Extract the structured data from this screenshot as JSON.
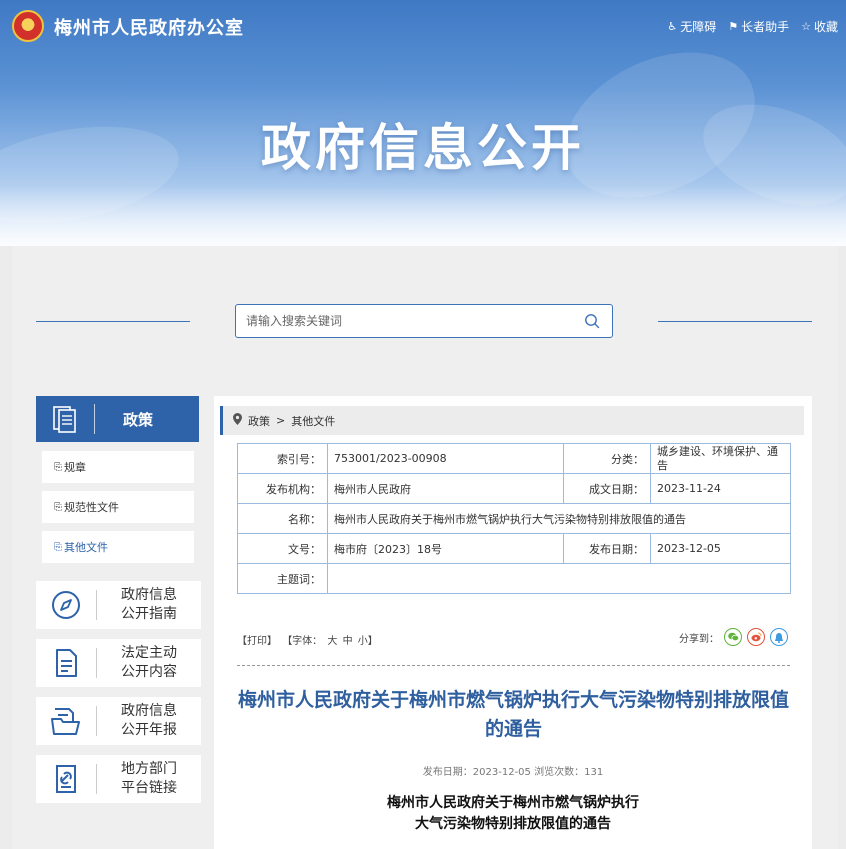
{
  "header": {
    "site_title": "梅州市人民政府办公室",
    "links": [
      {
        "icon": "wheelchair-icon",
        "label": "无障碍"
      },
      {
        "icon": "elder-helper-icon",
        "label": "长者助手"
      },
      {
        "icon": "star-icon",
        "label": "收藏"
      }
    ],
    "banner_title": "政府信息公开"
  },
  "search": {
    "placeholder": "请输入搜索关键词"
  },
  "sidebar": {
    "header_label": "政策",
    "sub_items": [
      {
        "label": "规章"
      },
      {
        "label": "规范性文件"
      },
      {
        "label": "其他文件"
      }
    ],
    "cards": [
      {
        "line1": "政府信息",
        "line2": "公开指南",
        "icon": "compass-icon"
      },
      {
        "line1": "法定主动",
        "line2": "公开内容",
        "icon": "document-list-icon"
      },
      {
        "line1": "政府信息",
        "line2": "公开年报",
        "icon": "folder-report-icon"
      },
      {
        "line1": "地方部门",
        "line2": "平台链接",
        "icon": "link-document-icon"
      }
    ]
  },
  "breadcrumb": {
    "items": [
      "政策",
      "其他文件"
    ],
    "separator": ">"
  },
  "info": {
    "index_label": "索引号：",
    "index_value": "753001/2023-00908",
    "category_label": "分类：",
    "category_value": "城乡建设、环境保护、通告",
    "org_label": "发布机构：",
    "org_value": "梅州市人民政府",
    "created_label": "成文日期：",
    "created_value": "2023-11-24",
    "name_label": "名称：",
    "name_value": "梅州市人民政府关于梅州市燃气锅炉执行大气污染物特别排放限值的通告",
    "doc_no_label": "文号：",
    "doc_no_value": "梅市府〔2023〕18号",
    "published_label": "发布日期：",
    "published_value": "2023-12-05",
    "subject_label": "主题词："
  },
  "tools": {
    "print": "【打印】",
    "font_label": "【字体：",
    "font_large": "大",
    "font_medium": "中",
    "font_small": "小】",
    "share_label": "分享到："
  },
  "article": {
    "title": "梅州市人民政府关于梅州市燃气锅炉执行大气污染物特别排放限值的通告",
    "meta": "发布日期：2023-12-05  浏览次数：131",
    "sub_line1": "梅州市人民政府关于梅州市燃气锅炉执行",
    "sub_line2": "大气污染物特别排放限值的通告"
  },
  "colors": {
    "primary": "#2e63a9",
    "title_blue": "#2f5f9e",
    "wechat": "#5fb43b",
    "weibo": "#e2553c",
    "qzone": "#3d9be0"
  }
}
